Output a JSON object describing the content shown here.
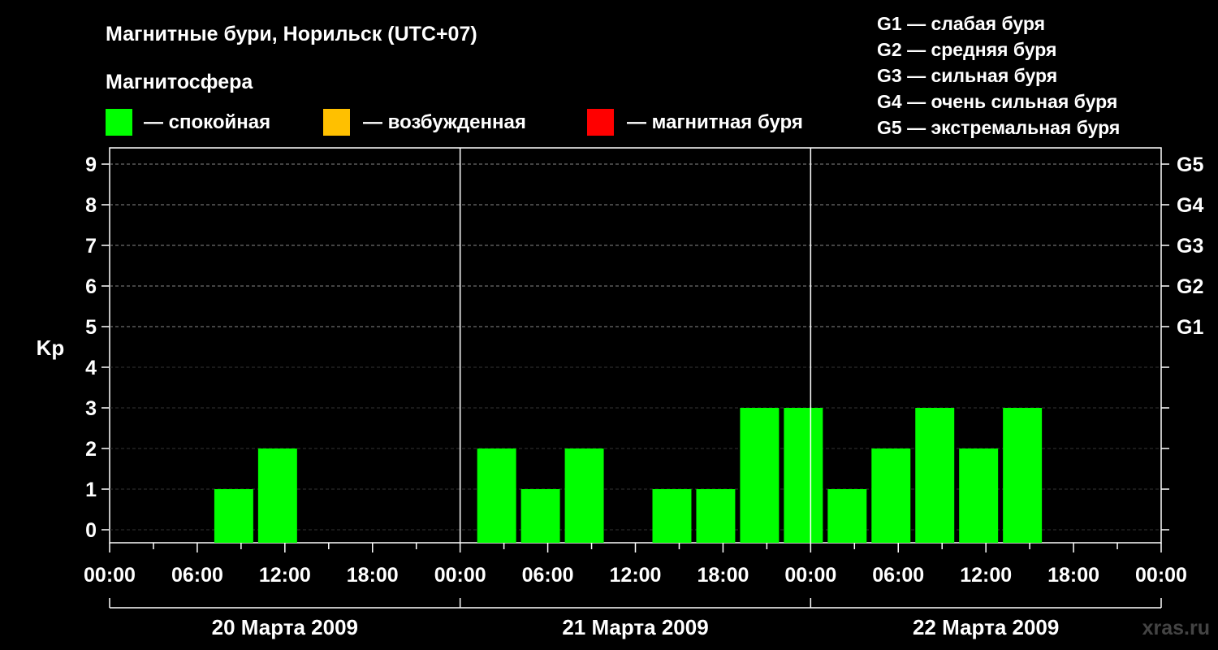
{
  "title": "Магнитные бури, Норильск (UTC+07)",
  "legend": {
    "heading": "Магнитосфера",
    "items": [
      {
        "label": "— спокойная",
        "color": "#00ff00"
      },
      {
        "label": "— возбужденная",
        "color": "#ffc000"
      },
      {
        "label": "— магнитная буря",
        "color": "#ff0000"
      }
    ]
  },
  "g_scale": [
    "G1 — слабая буря",
    "G2 — средняя буря",
    "G3 — сильная буря",
    "G4 — очень сильная буря",
    "G5 — экстремальная буря"
  ],
  "watermark": "xras.ru",
  "chart_data": {
    "type": "bar",
    "ylabel": "Kp",
    "ylim": [
      0,
      9
    ],
    "yticks": [
      "0",
      "1",
      "2",
      "3",
      "4",
      "5",
      "6",
      "7",
      "8",
      "9"
    ],
    "right_ticks": [
      {
        "kp": 5,
        "label": "G1"
      },
      {
        "kp": 6,
        "label": "G2"
      },
      {
        "kp": 7,
        "label": "G3"
      },
      {
        "kp": 8,
        "label": "G4"
      },
      {
        "kp": 9,
        "label": "G5"
      }
    ],
    "grid": "horizontal dashed",
    "xticks": [
      "00:00",
      "06:00",
      "12:00",
      "18:00",
      "00:00",
      "06:00",
      "12:00",
      "18:00",
      "00:00",
      "06:00",
      "12:00",
      "18:00",
      "00:00"
    ],
    "days": [
      "20 Марта 2009",
      "21 Марта 2009",
      "22 Марта 2009"
    ],
    "interval_hours": 3,
    "series": [
      {
        "color": "#00ff00",
        "values": [
          null,
          null,
          1,
          2,
          null,
          null,
          null,
          null,
          2,
          1,
          2,
          null,
          1,
          1,
          3,
          3,
          1,
          2,
          3,
          2,
          3,
          null,
          null,
          null
        ]
      }
    ]
  }
}
